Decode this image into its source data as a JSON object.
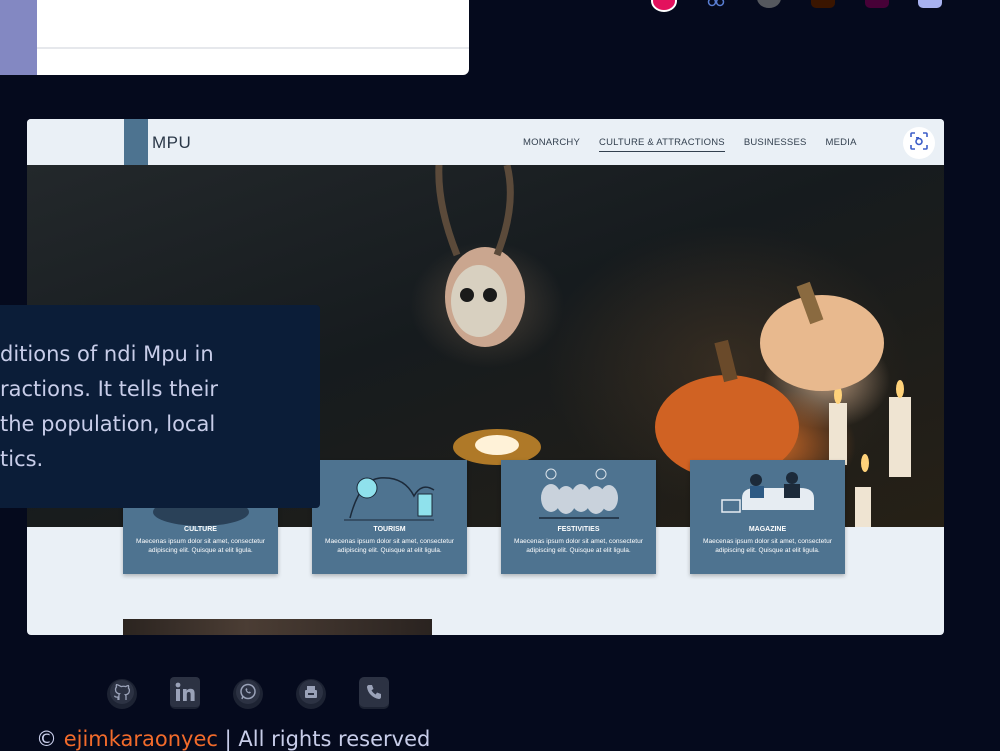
{
  "site": {
    "logo": "MPU",
    "nav": [
      "MONARCHY",
      "CULTURE & ATTRACTIONS",
      "BUSINESSES",
      "MEDIA"
    ],
    "active_nav": "CULTURE & ATTRACTIONS"
  },
  "cards": [
    {
      "title": "CULTURE",
      "desc": "Maecenas ipsum dolor sit amet, consectetur adipiscing elit. Quisque at elit ligula."
    },
    {
      "title": "TOURISM",
      "desc": "Maecenas ipsum dolor sit amet, consectetur adipiscing elit. Quisque at elit ligula."
    },
    {
      "title": "FESTIVITIES",
      "desc": "Maecenas ipsum dolor sit amet, consectetur adipiscing elit. Quisque at elit ligula."
    },
    {
      "title": "MAGAZINE",
      "desc": "Maecenas ipsum dolor sit amet, consectetur adipiscing elit. Quisque at elit ligula."
    }
  ],
  "overlay_lines": [
    "ditions of ndi Mpu in",
    "ractions. It tells their",
    " the population, local",
    "tics."
  ],
  "footer": {
    "copyright": "©",
    "brand": "ejimkaraonyec",
    "rest": "| All rights reserved"
  },
  "icons": [
    "github-icon",
    "linkedin-icon",
    "whatsapp-icon",
    "fax-icon",
    "phone-icon",
    "scan-icon"
  ],
  "colors": {
    "page_bg": "#050a1d",
    "card_bg": "#4e7390",
    "accent_orange": "#f26b2b",
    "overlay_bg": "#0b1d38"
  }
}
